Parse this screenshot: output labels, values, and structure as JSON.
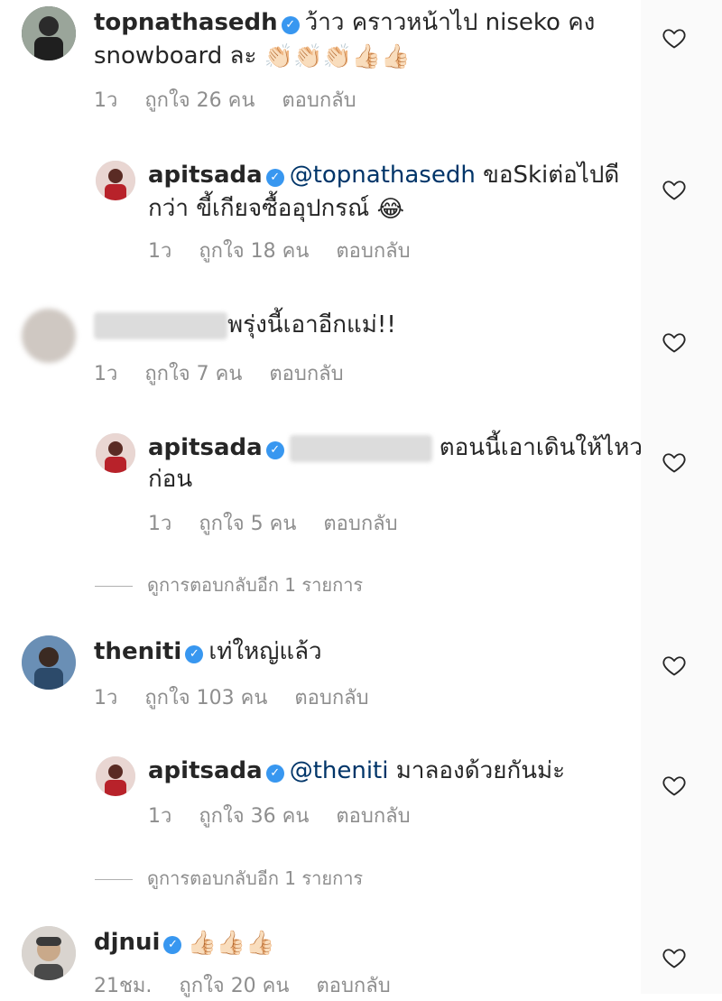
{
  "comments": [
    {
      "username": "topnathasedh",
      "text": "ว้าว คราวหน้าไป niseko คง",
      "text2": "snowboard ละ",
      "emoji": "👏🏻👏🏻👏🏻👍🏻👍🏻",
      "time": "1ว",
      "likes": "ถูกใจ 26 คน",
      "reply": "ตอบกลับ"
    },
    {
      "username": "apitsada",
      "mention": "@topnathasedh",
      "text": "ขอSkiต่อไปดี",
      "text2": "กว่า ขี้เกียจซื้ออุปกรณ์",
      "emoji": "😂",
      "time": "1ว",
      "likes": "ถูกใจ 18 คน",
      "reply": "ตอบกลับ"
    },
    {
      "text": "พรุ่งนี้เอาอีกแม่!!",
      "time": "1ว",
      "likes": "ถูกใจ 7 คน",
      "reply": "ตอบกลับ"
    },
    {
      "username": "apitsada",
      "text": "ตอนนี้เอาเดินให้ไหว",
      "text2": "ก่อน",
      "time": "1ว",
      "likes": "ถูกใจ 5 คน",
      "reply": "ตอบกลับ"
    },
    {
      "username": "theniti",
      "text": "เท่ใหญ่แล้ว",
      "time": "1ว",
      "likes": "ถูกใจ 103 คน",
      "reply": "ตอบกลับ"
    },
    {
      "username": "apitsada",
      "mention": "@theniti",
      "text": "มาลองด้วยกันม่ะ",
      "time": "1ว",
      "likes": "ถูกใจ 36 คน",
      "reply": "ตอบกลับ"
    },
    {
      "username": "djnui",
      "emoji": "👍🏻👍🏻👍🏻",
      "time": "21ชม.",
      "likes": "ถูกใจ 20 คน",
      "reply": "ตอบกลับ"
    }
  ],
  "view_more_1": "ดูการตอบกลับอีก 1 รายการ",
  "view_more_2": "ดูการตอบกลับอีก 1 รายการ",
  "colors": {
    "verified": "#3897f0",
    "mention": "#003569",
    "meta": "#8e8e8e"
  },
  "icons": {
    "like": "heart-outline-icon",
    "verified": "verified-badge-icon"
  }
}
